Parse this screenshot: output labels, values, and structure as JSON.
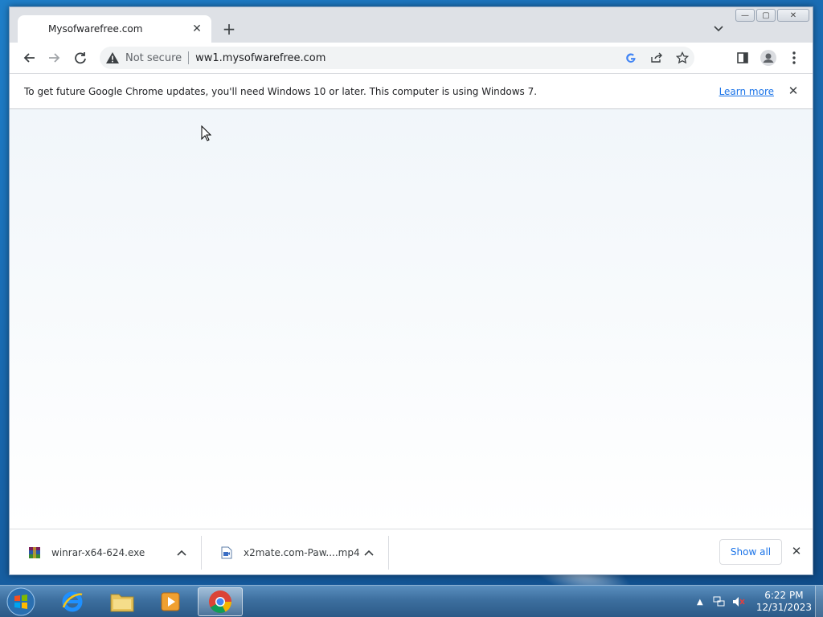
{
  "browser": {
    "tab": {
      "title": "Mysofwarefree.com",
      "close": "✕"
    },
    "new_tab": "+",
    "caption": {
      "minimize": "—",
      "maximize": "▢",
      "close": "✕"
    }
  },
  "toolbar": {
    "security_label": "Not secure",
    "url": "ww1.mysofwarefree.com"
  },
  "infobar": {
    "message": "To get future Google Chrome updates, you'll need Windows 10 or later. This computer is using Windows 7.",
    "link": "Learn more",
    "close": "✕"
  },
  "downloads": {
    "items": [
      {
        "name": "winrar-x64-624.exe",
        "icon": "winrar-icon"
      },
      {
        "name": "x2mate.com-Paw....mp4",
        "icon": "video-file-icon"
      }
    ],
    "show_all": "Show all",
    "close": "✕"
  },
  "taskbar": {
    "time": "6:22 PM",
    "date": "12/31/2023",
    "apps": [
      "internet-explorer",
      "file-explorer",
      "media-player",
      "chrome"
    ]
  },
  "colors": {
    "link": "#1a73e8",
    "desktop": "#1a6cb3",
    "taskbar": "#3d6f9f"
  }
}
